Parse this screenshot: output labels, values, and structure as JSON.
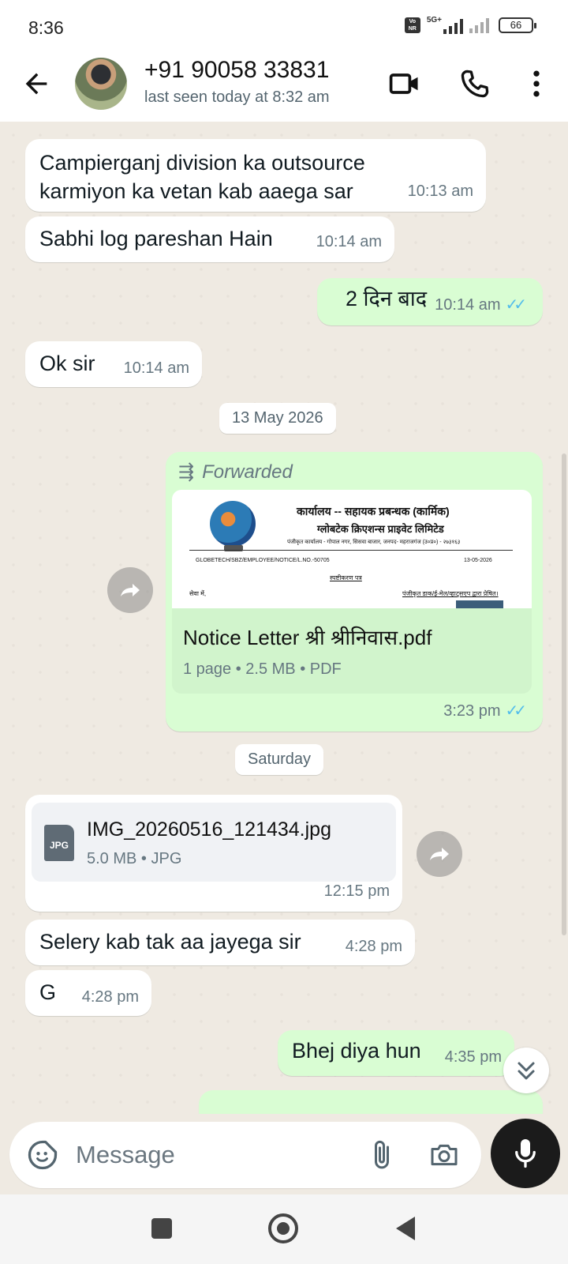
{
  "status_bar": {
    "time": "8:36",
    "volte": "Vo NR",
    "network": "5G+",
    "battery": "66"
  },
  "header": {
    "contact_name": "+91 90058 33831",
    "contact_status": "last seen today at 8:32 am",
    "icons": [
      "back-arrow-icon",
      "video-call-icon",
      "voice-call-icon",
      "more-vert-icon"
    ]
  },
  "messages": [
    {
      "dir": "in",
      "text": "Campierganj division ka outsource karmiyon ka vetan kab aaega sar",
      "time": "10:13 am"
    },
    {
      "dir": "in",
      "text": "Sabhi log pareshan Hain",
      "time": "10:14 am"
    },
    {
      "dir": "out",
      "text": "2 दिन बाद",
      "time": "10:14 am",
      "status": "read"
    },
    {
      "dir": "in",
      "text": "Ok sir",
      "time": "10:14 am"
    },
    {
      "dir": "date",
      "text": "13 May 2026"
    },
    {
      "dir": "out",
      "type": "document",
      "forwarded_label": "Forwarded",
      "file_name": "Notice Letter श्री श्रीनिवास.pdf",
      "file_meta": "1 page • 2.5 MB • PDF",
      "time": "3:23 pm",
      "status": "read",
      "preview": {
        "office_line": "कार्यालय -- सहायक प्रबन्धक (कार्मिक)",
        "company_line": "ग्लोबटेक क्रिएशन्स प्राइवेट लिमिटेड",
        "address_line": "पंजीकृत कार्यालय - गोपाल नगर, सिसवा बाजार, जनपद- महराजगंज (उ०प्र०) - २७३१६३",
        "ref_no": "GLOBETECH/SBZ/EMPLOYEE/NOTICE/L.NO.-50705",
        "date": "13-05-2026",
        "subject": "स्पष्टीकरण पत्र",
        "to_line": "सेवा में,",
        "dispatch_line": "पंजीकृत डाक/ई-मेल/व्हाट्सएप द्वारा प्रेषित।"
      }
    },
    {
      "dir": "date",
      "text": "Saturday"
    },
    {
      "dir": "in",
      "type": "document",
      "file_name": "IMG_20260516_121434.jpg",
      "file_meta": "5.0 MB • JPG",
      "file_badge": "JPG",
      "time": "12:15 pm"
    },
    {
      "dir": "in",
      "text": "Selery kab tak aa jayega sir",
      "time": "4:28 pm"
    },
    {
      "dir": "in",
      "text": "G",
      "time": "4:28 pm"
    },
    {
      "dir": "out",
      "text": "Bhej diya hun",
      "time": "4:35 pm",
      "status": "read"
    }
  ],
  "input": {
    "placeholder": "Message",
    "icons": [
      "sticker-icon",
      "attach-icon",
      "camera-icon",
      "mic-icon"
    ]
  },
  "colors": {
    "chat_bg": "#efeae2",
    "outgoing_bubble": "#d9fdd3",
    "incoming_bubble": "#ffffff",
    "read_tick": "#53bdeb"
  }
}
